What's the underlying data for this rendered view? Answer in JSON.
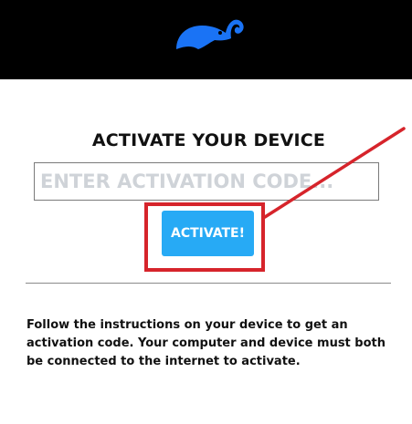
{
  "header": {
    "logo_icon": "elephant-logo-icon",
    "logo_color": "#1a73f5",
    "background_color": "#000000"
  },
  "activation": {
    "heading": "ACTIVATE YOUR DEVICE",
    "code_placeholder": "ENTER ACTIVATION CODE...",
    "code_value": "",
    "button_label": "ACTIVATE!",
    "button_color": "#27aaf5"
  },
  "annotation": {
    "highlight_color": "#d6242b",
    "pointer_icon": "red-arrow-line"
  },
  "instructions": {
    "text": "Follow the instructions on your device to get an activation code. Your computer and device must both be connected to the internet to activate."
  }
}
